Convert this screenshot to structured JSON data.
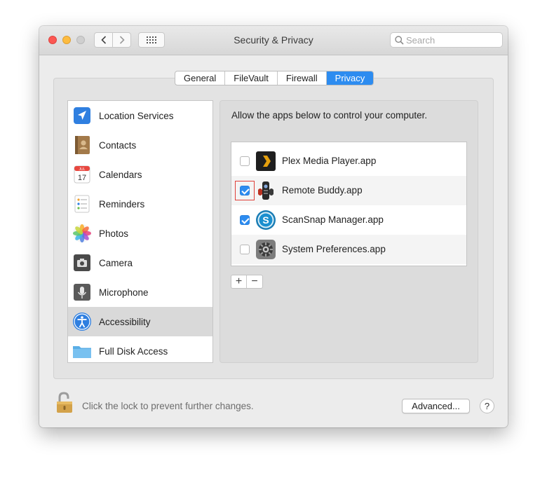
{
  "window": {
    "title": "Security & Privacy",
    "search_placeholder": "Search"
  },
  "tabs": [
    {
      "label": "General",
      "active": false
    },
    {
      "label": "FileVault",
      "active": false
    },
    {
      "label": "Firewall",
      "active": false
    },
    {
      "label": "Privacy",
      "active": true
    }
  ],
  "sidebar": {
    "items": [
      {
        "label": "Location Services",
        "icon": "location-arrow-icon"
      },
      {
        "label": "Contacts",
        "icon": "contacts-book-icon"
      },
      {
        "label": "Calendars",
        "icon": "calendar-icon"
      },
      {
        "label": "Reminders",
        "icon": "reminders-list-icon"
      },
      {
        "label": "Photos",
        "icon": "photos-flower-icon"
      },
      {
        "label": "Camera",
        "icon": "camera-icon"
      },
      {
        "label": "Microphone",
        "icon": "microphone-icon"
      },
      {
        "label": "Accessibility",
        "icon": "accessibility-icon",
        "selected": true
      },
      {
        "label": "Full Disk Access",
        "icon": "folder-icon"
      }
    ],
    "calendar_month": "JUL",
    "calendar_day": "17"
  },
  "main": {
    "heading": "Allow the apps below to control your computer.",
    "apps": [
      {
        "name": "Plex Media Player.app",
        "checked": false,
        "icon": "plex-icon"
      },
      {
        "name": "Remote Buddy.app",
        "checked": true,
        "icon": "remote-buddy-icon",
        "highlighted": true
      },
      {
        "name": "ScanSnap Manager.app",
        "checked": true,
        "icon": "scansnap-icon"
      },
      {
        "name": "System Preferences.app",
        "checked": false,
        "icon": "system-preferences-gear-icon"
      }
    ],
    "add_label": "+",
    "remove_label": "−"
  },
  "footer": {
    "lock_text": "Click the lock to prevent further changes.",
    "advanced_label": "Advanced...",
    "help_label": "?"
  },
  "colors": {
    "accent": "#2d8cf0",
    "highlight_border": "#e0403a"
  }
}
